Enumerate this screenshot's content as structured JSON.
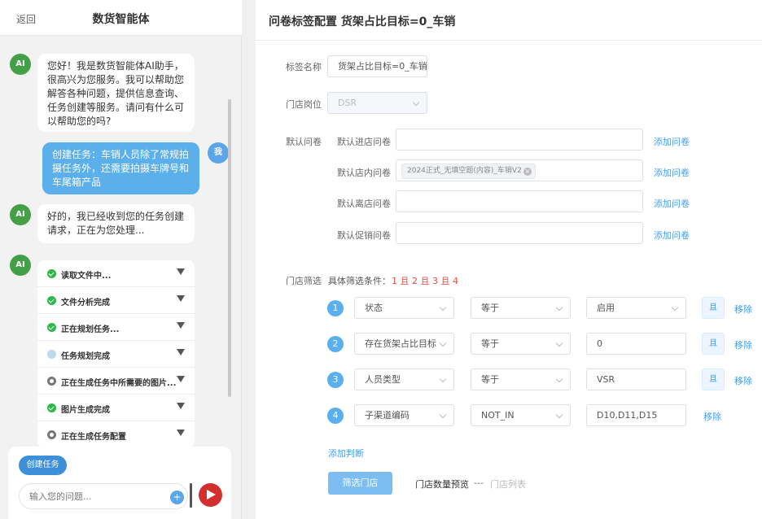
{
  "left": {
    "back": "返回",
    "title": "数货智能体",
    "messages": [
      {
        "role": "ai",
        "avatar": "AI",
        "text": "您好！我是数货智能体AI助手，很高兴为您服务。我可以帮助您解答各种问题，提供信息查询、任务创建等服务。请问有什么可以帮助您的吗?"
      },
      {
        "role": "user",
        "avatar": "我",
        "text": "创建任务：车销人员除了常规拍摄任务外，还需要拍摄车牌号和车尾箱产品"
      },
      {
        "role": "ai",
        "avatar": "AI",
        "text": "好的，我已经收到您的任务创建请求，正在为您处理..."
      },
      {
        "role": "ai",
        "avatar": "AI",
        "text": ""
      }
    ],
    "steps": [
      {
        "label": "读取文件中...",
        "status": "done"
      },
      {
        "label": "文件分析完成",
        "status": "done"
      },
      {
        "label": "正在规划任务...",
        "status": "done"
      },
      {
        "label": "任务规划完成",
        "status": "waiting"
      },
      {
        "label": "正在生成任务中所需要的图片...",
        "status": "running"
      },
      {
        "label": "图片生成完成",
        "status": "done"
      },
      {
        "label": "正在生成任务配置",
        "status": "running"
      }
    ],
    "create_task": "创建任务",
    "input_placeholder": "输入您的问题...",
    "plus": "+"
  },
  "right": {
    "title": "问卷标签配置 货架占比目标=0_车销",
    "tag_name_label": "标签名称",
    "tag_name_value": "货架占比目标=0_车销",
    "position_label": "门店岗位",
    "position_value": "DSR",
    "default_label": "默认问卷",
    "questionnaires": [
      {
        "label": "默认进店问卷",
        "value": "",
        "add": "添加问卷"
      },
      {
        "label": "默认店内问卷",
        "value": "2024正式_无填空题(内容)_车销V2",
        "add": "添加问卷"
      },
      {
        "label": "默认离店问卷",
        "value": "",
        "add": "添加问卷"
      },
      {
        "label": "默认促销问卷",
        "value": "",
        "add": "添加问卷"
      }
    ],
    "filter_label": "门店筛选",
    "condition_label": "具体筛选条件：",
    "condition_expr": "1 且 2 且 3 且 4",
    "conditions": [
      {
        "num": "1",
        "field": "状态",
        "op": "等于",
        "value": "启用",
        "value_is_select": true,
        "and": "且",
        "remove": "移除"
      },
      {
        "num": "2",
        "field": "存在货架占比目标",
        "op": "等于",
        "value": "0",
        "value_is_select": false,
        "and": "且",
        "remove": "移除"
      },
      {
        "num": "3",
        "field": "人员类型",
        "op": "等于",
        "value": "VSR",
        "value_is_select": false,
        "and": "且",
        "remove": "移除"
      },
      {
        "num": "4",
        "field": "子渠道编码",
        "op": "NOT_IN",
        "value": "D10,D11,D15",
        "value_is_select": false,
        "and": "",
        "remove": "移除"
      }
    ],
    "add_condition": "添加判断",
    "filter_button": "筛选门店",
    "preview_label": "门店数量预览",
    "preview_dash": "---",
    "store_list": "门店列表"
  }
}
